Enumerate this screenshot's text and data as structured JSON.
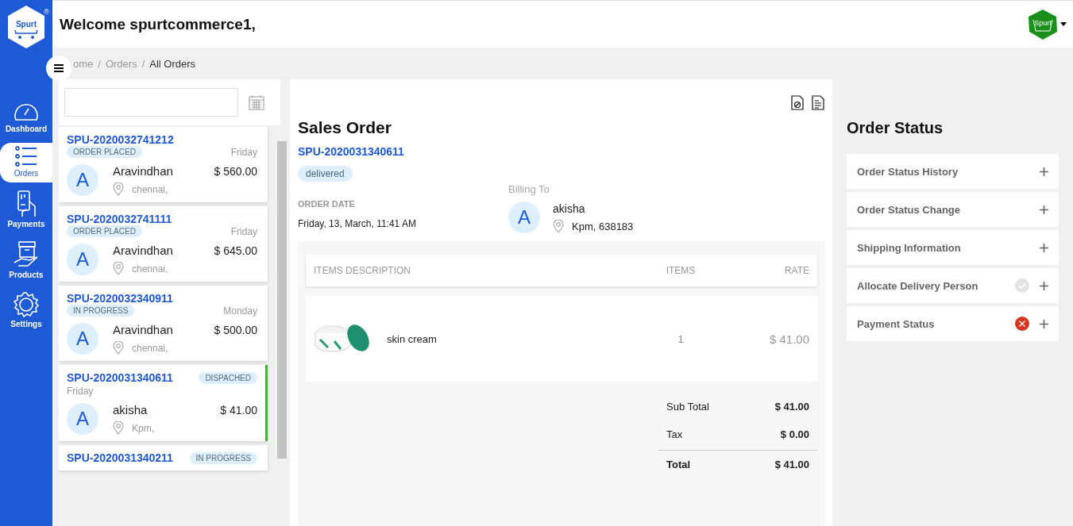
{
  "header": {
    "welcome": "Welcome spurtcommerce1,",
    "logo_text": "Spurt",
    "logo_mark": "®",
    "avatar_text": "Spurt"
  },
  "sidebar": {
    "items": [
      {
        "label": "Dashboard",
        "kind": "dashboard",
        "selected": false
      },
      {
        "label": "Orders",
        "kind": "orders",
        "selected": true
      },
      {
        "label": "Payments",
        "kind": "payments",
        "selected": false
      },
      {
        "label": "Products",
        "kind": "products",
        "selected": false
      },
      {
        "label": "Settings",
        "kind": "settings",
        "selected": false
      }
    ]
  },
  "breadcrumb": [
    {
      "label": "ome"
    },
    {
      "separator": "/",
      "label": "Orders"
    },
    {
      "separator": "/",
      "label": "All Orders"
    }
  ],
  "orders": [
    {
      "id": "SPU-2020032741212",
      "status": "ORDER PLACED",
      "day": "Friday",
      "initial": "A",
      "name": "Aravindhan",
      "amount": "$ 560.00",
      "city": "chennai,",
      "kind": "stacked",
      "selected": false
    },
    {
      "id": "SPU-2020032741111",
      "status": "ORDER PLACED",
      "day": "Friday",
      "initial": "A",
      "name": "Aravindhan",
      "amount": "$ 645.00",
      "city": "chennai,",
      "kind": "stacked",
      "selected": false
    },
    {
      "id": "SPU-2020032340911",
      "status": "IN PROGRESS",
      "day": "Monday",
      "initial": "A",
      "name": "Aravindhan",
      "amount": "$ 500.00",
      "city": "chennai,",
      "kind": "stacked",
      "selected": false
    },
    {
      "id": "SPU-2020031340611",
      "status": "DISPACHED",
      "day": "Friday",
      "initial": "A",
      "name": "akisha",
      "amount": "$ 41.00",
      "city": "Kpm,",
      "kind": "inline",
      "selected": true
    },
    {
      "id": "SPU-2020031340211",
      "status": "IN PROGRESS",
      "kind": "inline",
      "selected": false
    }
  ],
  "sales_order": {
    "title": "Sales Order",
    "id": "SPU-2020031340611",
    "status": "delivered",
    "order_date_label": "ORDER DATE",
    "order_date": "Friday, 13, March, 11:41 AM",
    "billing_label": "Billing To",
    "billing_initial": "A",
    "billing_name": "akisha",
    "billing_address": "Kpm, 638183",
    "columns": [
      "ITEMS DESCRIPTION",
      "ITEMS",
      "RATE"
    ],
    "items": [
      {
        "name": "skin cream",
        "quantity": "1",
        "rate": "$ 41.00"
      }
    ],
    "totals": [
      {
        "label": "Sub Total",
        "value": "$ 41.00",
        "kind": "normal"
      },
      {
        "label": "Tax",
        "value": "$ 0.00",
        "kind": "normal"
      },
      {
        "label": "Total",
        "value": "$ 41.00",
        "kind": "grand"
      }
    ]
  },
  "order_status": {
    "title": "Order Status",
    "sections": [
      {
        "label": "Order Status History",
        "kind": "none"
      },
      {
        "label": "Order Status Change",
        "kind": "none"
      },
      {
        "label": "Shipping Information",
        "kind": "none"
      },
      {
        "label": "Allocate Delivery Person",
        "kind": "check"
      },
      {
        "label": "Payment Status",
        "kind": "cross"
      }
    ]
  }
}
